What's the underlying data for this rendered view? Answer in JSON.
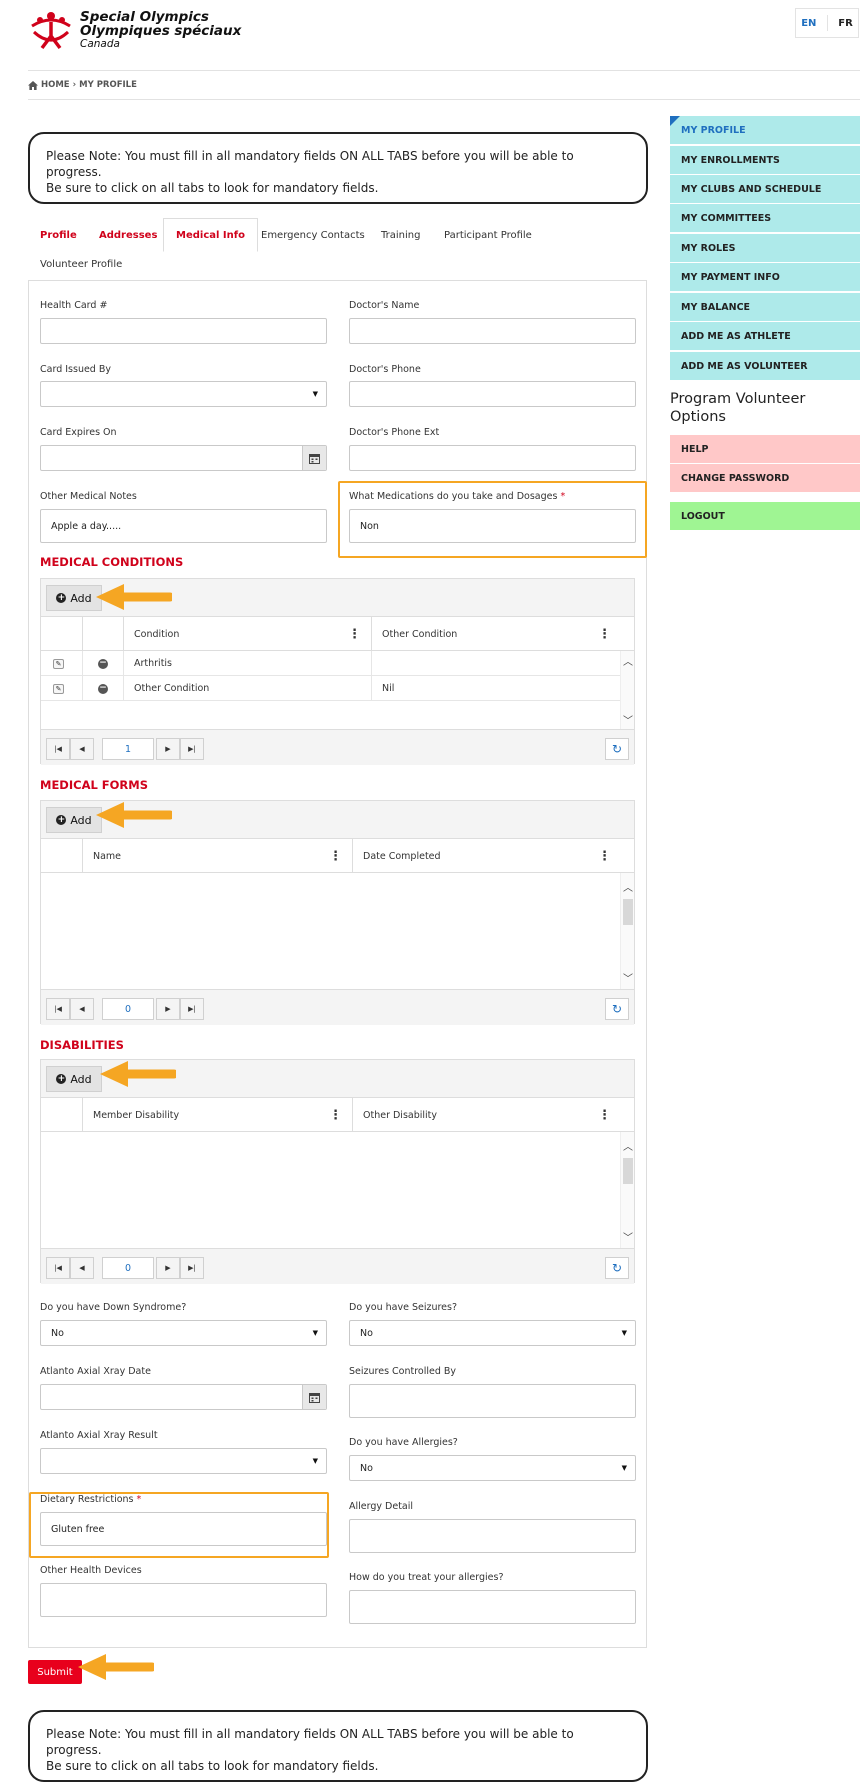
{
  "header": {
    "logo_line1": "Special Olympics",
    "logo_line2": "Olympiques spéciaux",
    "logo_line3": "Canada",
    "lang_en": "EN",
    "lang_fr": "FR"
  },
  "breadcrumb": {
    "home": "HOME",
    "current": "MY PROFILE"
  },
  "note_text_line1": "Please Note: You must fill in all mandatory fields ON ALL TABS before you will be able to progress.",
  "note_text_line2": "Be sure to click on all tabs to look for mandatory fields.",
  "tabs": [
    {
      "label": "Profile"
    },
    {
      "label": "Addresses"
    },
    {
      "label": "Medical Info"
    },
    {
      "label": "Emergency Contacts"
    },
    {
      "label": "Training"
    },
    {
      "label": "Participant Profile"
    },
    {
      "label": "Volunteer Profile"
    }
  ],
  "form": {
    "health_card_label": "Health Card #",
    "health_card_value": "",
    "doctor_name_label": "Doctor's Name",
    "doctor_name_value": "",
    "card_issued_label": "Card Issued By",
    "card_issued_value": "",
    "doctor_phone_label": "Doctor's Phone",
    "doctor_phone_value": "",
    "card_expires_label": "Card Expires On",
    "card_expires_value": "",
    "doctor_phone_ext_label": "Doctor's Phone Ext",
    "doctor_phone_ext_value": "",
    "other_notes_label": "Other Medical Notes",
    "other_notes_value": "Apple a day.....",
    "medications_label": "What Medications do you take and Dosages",
    "medications_value": "Non",
    "required_mark": "*"
  },
  "medical_conditions": {
    "title": "MEDICAL CONDITIONS",
    "add_label": "Add",
    "col_condition": "Condition",
    "col_other": "Other Condition",
    "rows": [
      {
        "condition": "Arthritis",
        "other": ""
      },
      {
        "condition": "Other Condition",
        "other": "Nil"
      }
    ],
    "page": "1"
  },
  "medical_forms": {
    "title": "MEDICAL FORMS",
    "add_label": "Add",
    "col_name": "Name",
    "col_date": "Date Completed",
    "page": "0"
  },
  "disabilities": {
    "title": "DISABILITIES",
    "add_label": "Add",
    "col_member": "Member Disability",
    "col_other": "Other Disability",
    "page": "0"
  },
  "form2": {
    "down_syndrome_label": "Do you have Down Syndrome?",
    "down_syndrome_value": "No",
    "seizures_label": "Do you have Seizures?",
    "seizures_value": "No",
    "atlanto_date_label": "Atlanto Axial Xray Date",
    "atlanto_date_value": "",
    "seizures_controlled_label": "Seizures Controlled By",
    "seizures_controlled_value": "",
    "atlanto_result_label": "Atlanto Axial Xray Result",
    "atlanto_result_value": "",
    "allergies_label": "Do you have Allergies?",
    "allergies_value": "No",
    "dietary_label": "Dietary Restrictions",
    "dietary_value": "Gluten free",
    "allergy_detail_label": "Allergy Detail",
    "allergy_detail_value": "",
    "other_devices_label": "Other Health Devices",
    "other_devices_value": "",
    "treat_allergies_label": "How do you treat your allergies?",
    "treat_allergies_value": ""
  },
  "submit_label": "Submit",
  "sidebar": {
    "items": [
      {
        "label": "MY PROFILE"
      },
      {
        "label": "MY ENROLLMENTS"
      },
      {
        "label": "MY CLUBS AND SCHEDULE"
      },
      {
        "label": "MY COMMITTEES"
      },
      {
        "label": "MY ROLES"
      },
      {
        "label": "MY PAYMENT INFO"
      },
      {
        "label": "MY BALANCE"
      },
      {
        "label": "ADD ME AS ATHLETE"
      },
      {
        "label": "ADD ME AS VOLUNTEER"
      }
    ],
    "program_title_line1": "Program Volunteer",
    "program_title_line2": "Options",
    "help": "HELP",
    "change_password": "CHANGE PASSWORD",
    "logout": "LOGOUT"
  },
  "colors": {
    "brand_red": "#d0021b",
    "sidebar_cyan": "#aeeaea",
    "sidebar_pink": "#ffc8c8",
    "sidebar_green": "#9ff593",
    "highlight_orange": "#f5a623",
    "link_blue": "#1f6fbf"
  }
}
